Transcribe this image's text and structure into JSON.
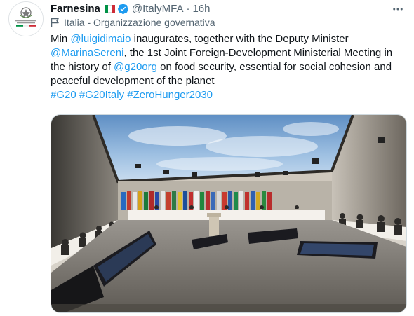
{
  "account": {
    "name": "Farnesina",
    "handle": "@ItalyMFA",
    "separator": "·",
    "time": "16h",
    "label": "Italia - Organizzazione governativa",
    "avatar_caption_1": "Ministero degli Affari Esteri",
    "avatar_caption_2": "e della Cooperazione Internazionale"
  },
  "tweet": {
    "t1": "Min ",
    "m1": "@luigidimaio",
    "t2": " inaugurates, together with the Deputy Minister ",
    "m2": "@MarinaSereni",
    "t3": ", the 1st Joint Foreign-Development Ministerial Meeting in the history of ",
    "m3": "@g20org",
    "t4": " on food security, essential for social cohesion and peaceful development of the planet",
    "h1": "#G20",
    "h2": "#G20Italy",
    "h3": "#ZeroHunger2030"
  },
  "icons": {
    "more": "more-horizontal-icon",
    "verified": "verified-badge-icon",
    "flag": "italy-flag-icon",
    "label": "flag-label-icon"
  },
  "colors": {
    "link": "#1d9bf0",
    "text": "#0f1419",
    "secondary": "#536471",
    "verified": "#1d9bf0",
    "flag_green": "#009246",
    "flag_white": "#ffffff",
    "flag_red": "#ce2b37"
  },
  "media": {
    "type": "photo",
    "subject": "G20 ministerial meeting hall"
  }
}
